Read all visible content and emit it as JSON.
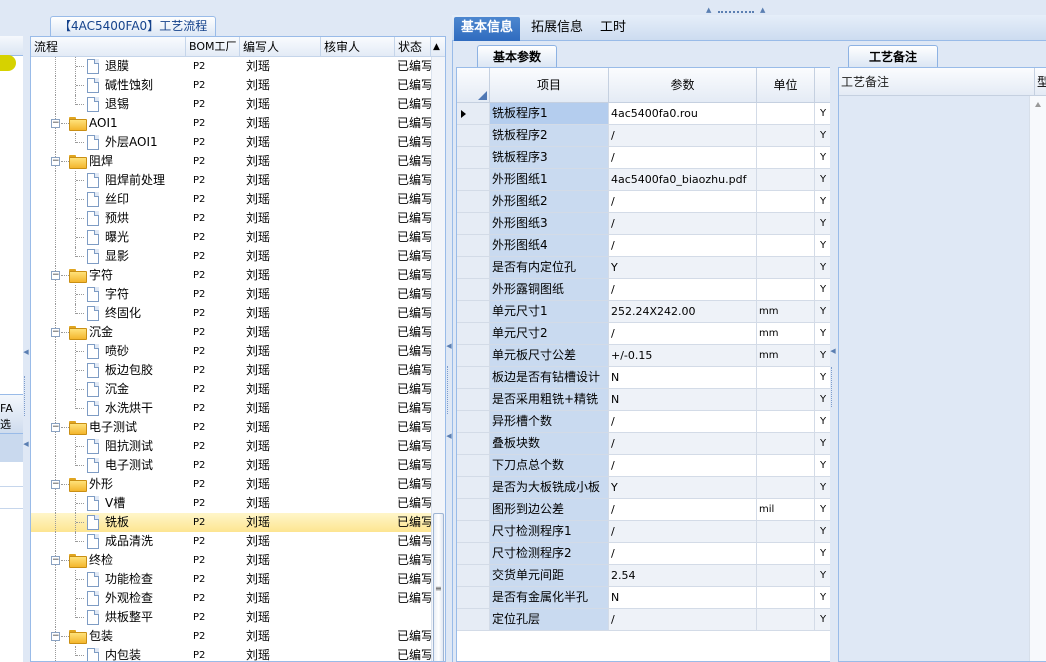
{
  "tree_panel": {
    "title": "【4AC5400FA0】工艺流程",
    "columns": [
      "流程",
      "BOM工厂",
      "编写人",
      "核审人",
      "状态"
    ],
    "rows": [
      {
        "level": 2,
        "label": "退膜",
        "bom": "P2",
        "writer": "刘瑶",
        "status": "已编写"
      },
      {
        "level": 2,
        "label": "碱性蚀刻",
        "bom": "P2",
        "writer": "刘瑶",
        "status": "已编写"
      },
      {
        "level": 2,
        "label": "退锡",
        "bom": "P2",
        "writer": "刘瑶",
        "status": "已编写"
      },
      {
        "level": 1,
        "label": "AOI1",
        "bom": "P2",
        "writer": "刘瑶",
        "status": "已编写"
      },
      {
        "level": 2,
        "label": "外层AOI1",
        "bom": "P2",
        "writer": "刘瑶",
        "status": "已编写"
      },
      {
        "level": 1,
        "label": "阻焊",
        "bom": "P2",
        "writer": "刘瑶",
        "status": "已编写"
      },
      {
        "level": 2,
        "label": "阻焊前处理",
        "bom": "P2",
        "writer": "刘瑶",
        "status": "已编写"
      },
      {
        "level": 2,
        "label": "丝印",
        "bom": "P2",
        "writer": "刘瑶",
        "status": "已编写"
      },
      {
        "level": 2,
        "label": "预烘",
        "bom": "P2",
        "writer": "刘瑶",
        "status": "已编写"
      },
      {
        "level": 2,
        "label": "曝光",
        "bom": "P2",
        "writer": "刘瑶",
        "status": "已编写"
      },
      {
        "level": 2,
        "label": "显影",
        "bom": "P2",
        "writer": "刘瑶",
        "status": "已编写"
      },
      {
        "level": 1,
        "label": "字符",
        "bom": "P2",
        "writer": "刘瑶",
        "status": "已编写"
      },
      {
        "level": 2,
        "label": "字符",
        "bom": "P2",
        "writer": "刘瑶",
        "status": "已编写"
      },
      {
        "level": 2,
        "label": "终固化",
        "bom": "P2",
        "writer": "刘瑶",
        "status": "已编写"
      },
      {
        "level": 1,
        "label": "沉金",
        "bom": "P2",
        "writer": "刘瑶",
        "status": "已编写"
      },
      {
        "level": 2,
        "label": "喷砂",
        "bom": "P2",
        "writer": "刘瑶",
        "status": "已编写"
      },
      {
        "level": 2,
        "label": "板边包胶",
        "bom": "P2",
        "writer": "刘瑶",
        "status": "已编写"
      },
      {
        "level": 2,
        "label": "沉金",
        "bom": "P2",
        "writer": "刘瑶",
        "status": "已编写"
      },
      {
        "level": 2,
        "label": "水洗烘干",
        "bom": "P2",
        "writer": "刘瑶",
        "status": "已编写"
      },
      {
        "level": 1,
        "label": "电子测试",
        "bom": "P2",
        "writer": "刘瑶",
        "status": "已编写"
      },
      {
        "level": 2,
        "label": "阻抗测试",
        "bom": "P2",
        "writer": "刘瑶",
        "status": "已编写"
      },
      {
        "level": 2,
        "label": "电子测试",
        "bom": "P2",
        "writer": "刘瑶",
        "status": "已编写"
      },
      {
        "level": 1,
        "label": "外形",
        "bom": "P2",
        "writer": "刘瑶",
        "status": "已编写"
      },
      {
        "level": 2,
        "label": "V槽",
        "bom": "P2",
        "writer": "刘瑶",
        "status": "已编写"
      },
      {
        "level": 2,
        "label": "铣板",
        "bom": "P2",
        "writer": "刘瑶",
        "status": "已编写",
        "selected": true
      },
      {
        "level": 2,
        "label": "成品清洗",
        "bom": "P2",
        "writer": "刘瑶",
        "status": "已编写"
      },
      {
        "level": 1,
        "label": "终检",
        "bom": "P2",
        "writer": "刘瑶",
        "status": "已编写"
      },
      {
        "level": 2,
        "label": "功能检查",
        "bom": "P2",
        "writer": "刘瑶",
        "status": "已编写"
      },
      {
        "level": 2,
        "label": "外观检查",
        "bom": "P2",
        "writer": "刘瑶",
        "status": "已编写"
      },
      {
        "level": 2,
        "label": "烘板整平",
        "bom": "P2",
        "writer": "刘瑶",
        "status": ""
      },
      {
        "level": 1,
        "label": "包装",
        "bom": "P2",
        "writer": "刘瑶",
        "status": "已编写"
      },
      {
        "level": 2,
        "label": "内包装",
        "bom": "P2",
        "writer": "刘瑶",
        "status": "已编写"
      }
    ]
  },
  "left_strip": {
    "label_top": "FA",
    "label_bottom": "选"
  },
  "tabs": [
    "基本信息",
    "拓展信息",
    "工时"
  ],
  "param_panel": {
    "subtab": "基本参数",
    "columns": {
      "item": "项目",
      "value": "参数",
      "unit": "单位"
    },
    "rows": [
      {
        "item": "铣板程序1",
        "value": "4ac5400fa0.rou",
        "unit": "",
        "flag": "Y"
      },
      {
        "item": "铣板程序2",
        "value": "/",
        "unit": "",
        "flag": "Y"
      },
      {
        "item": "铣板程序3",
        "value": "/",
        "unit": "",
        "flag": "Y"
      },
      {
        "item": "外形图纸1",
        "value": "4ac5400fa0_biaozhu.pdf",
        "unit": "",
        "flag": "Y"
      },
      {
        "item": "外形图纸2",
        "value": "/",
        "unit": "",
        "flag": "Y"
      },
      {
        "item": "外形图纸3",
        "value": "/",
        "unit": "",
        "flag": "Y"
      },
      {
        "item": "外形图纸4",
        "value": "/",
        "unit": "",
        "flag": "Y"
      },
      {
        "item": "是否有内定位孔",
        "value": "Y",
        "unit": "",
        "flag": "Y"
      },
      {
        "item": "外形露铜图纸",
        "value": "/",
        "unit": "",
        "flag": "Y"
      },
      {
        "item": "单元尺寸1",
        "value": "252.24X242.00",
        "unit": "mm",
        "flag": "Y"
      },
      {
        "item": "单元尺寸2",
        "value": "/",
        "unit": "mm",
        "flag": "Y"
      },
      {
        "item": "单元板尺寸公差",
        "value": "+/-0.15",
        "unit": "mm",
        "flag": "Y"
      },
      {
        "item": "板边是否有钻槽设计",
        "value": "N",
        "unit": "",
        "flag": "Y"
      },
      {
        "item": "是否采用粗铣+精铣",
        "value": "N",
        "unit": "",
        "flag": "Y"
      },
      {
        "item": "异形槽个数",
        "value": "/",
        "unit": "",
        "flag": "Y"
      },
      {
        "item": "叠板块数",
        "value": "/",
        "unit": "",
        "flag": "Y"
      },
      {
        "item": "下刀点总个数",
        "value": "/",
        "unit": "",
        "flag": "Y"
      },
      {
        "item": "是否为大板铣成小板",
        "value": "Y",
        "unit": "",
        "flag": "Y"
      },
      {
        "item": "图形到边公差",
        "value": "/",
        "unit": "mil",
        "flag": "Y"
      },
      {
        "item": "尺寸检测程序1",
        "value": "/",
        "unit": "",
        "flag": "Y"
      },
      {
        "item": "尺寸检测程序2",
        "value": "/",
        "unit": "",
        "flag": "Y"
      },
      {
        "item": "交货单元间距",
        "value": "2.54",
        "unit": "",
        "flag": "Y"
      },
      {
        "item": "是否有金属化半孔",
        "value": "N",
        "unit": "",
        "flag": "Y"
      },
      {
        "item": "定位孔层",
        "value": "/",
        "unit": "",
        "flag": "Y"
      }
    ]
  },
  "notes_panel": {
    "subtab": "工艺备注",
    "column": "工艺备注",
    "column2": "型"
  }
}
